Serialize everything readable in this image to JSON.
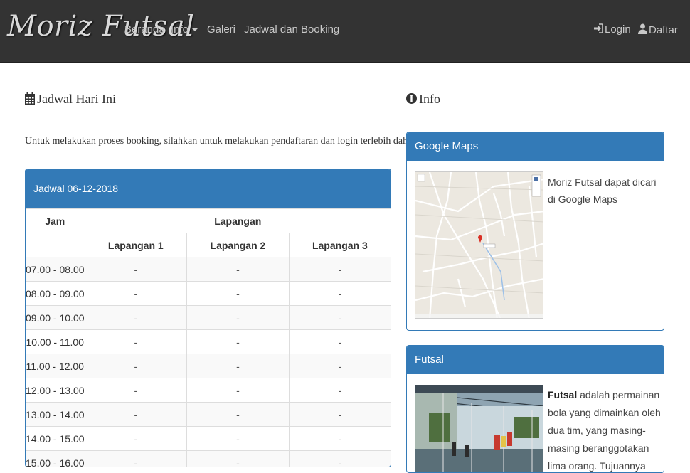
{
  "navbar": {
    "brand": "Moriz Futsal",
    "menu": {
      "beranda": "Beranda",
      "info": "Info",
      "galeri": "Galeri",
      "jadwal": "Jadwal dan Booking"
    },
    "login": "Login",
    "daftar": "Daftar",
    "login_icon": "sign-in-icon",
    "daftar_icon": "user-icon"
  },
  "schedule": {
    "heading": "Jadwal Hari Ini",
    "heading_icon": "calendar-icon",
    "note": "Untuk melakukan proses booking, silahkan untuk melakukan pendaftaran dan login terlebih dahulu.",
    "panel_title": "Jadwal 06-12-2018",
    "col_jam": "Jam",
    "col_lapangan": "Lapangan",
    "courts": [
      "Lapangan 1",
      "Lapangan 2",
      "Lapangan 3"
    ],
    "rows": [
      {
        "jam": "07.00 - 08.00",
        "c1": "-",
        "c2": "-",
        "c3": "-"
      },
      {
        "jam": "08.00 - 09.00",
        "c1": "-",
        "c2": "-",
        "c3": "-"
      },
      {
        "jam": "09.00 - 10.00",
        "c1": "-",
        "c2": "-",
        "c3": "-"
      },
      {
        "jam": "10.00 - 11.00",
        "c1": "-",
        "c2": "-",
        "c3": "-"
      },
      {
        "jam": "11.00 - 12.00",
        "c1": "-",
        "c2": "-",
        "c3": "-"
      },
      {
        "jam": "12.00 - 13.00",
        "c1": "-",
        "c2": "-",
        "c3": "-"
      },
      {
        "jam": "13.00 - 14.00",
        "c1": "-",
        "c2": "-",
        "c3": "-"
      },
      {
        "jam": "14.00 - 15.00",
        "c1": "-",
        "c2": "-",
        "c3": "-"
      },
      {
        "jam": "15.00 - 16.00",
        "c1": "-",
        "c2": "-",
        "c3": "-"
      }
    ]
  },
  "info": {
    "heading": "Info",
    "heading_icon": "info-circle-icon",
    "maps_title": "Google Maps",
    "maps_text": "Moriz Futsal dapat dicari di Google Maps",
    "futsal_title": "Futsal",
    "futsal_bold": "Futsal",
    "futsal_text": " adalah permainan bola yang dimainkan oleh dua tim, yang masing-masing beranggotakan lima orang. Tujuannya adalah memasukkan bola"
  },
  "colors": {
    "navbar_bg": "#333333",
    "panel_primary": "#337ab7"
  }
}
